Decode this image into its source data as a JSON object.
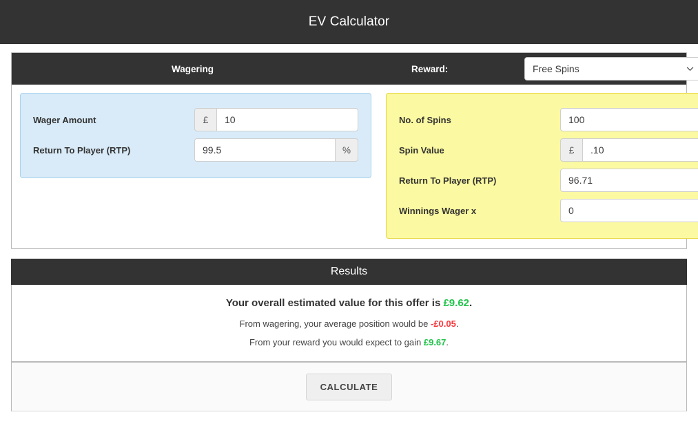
{
  "app": {
    "title": "EV Calculator",
    "accent_dark": "#333333",
    "panel_wagering_bg": "#d9ebf8",
    "panel_reward_bg": "#fbf9a1",
    "positive_color": "#21c44a",
    "negative_color": "#f8373d"
  },
  "card_header": {
    "wagering_label": "Wagering",
    "reward_label": "Reward:",
    "reward_select": {
      "value": "Free Spins",
      "options": [
        "Free Spins"
      ]
    },
    "chevron_icon": "chevron-down-icon"
  },
  "wagering_panel": {
    "fields": [
      {
        "label": "Wager Amount",
        "prefix": "£",
        "suffix": "",
        "value": "10",
        "placeholder": ""
      },
      {
        "label": "Return To Player (RTP)",
        "prefix": "",
        "suffix": "%",
        "value": "99.5",
        "placeholder": ""
      }
    ]
  },
  "reward_panel": {
    "fields": [
      {
        "label": "No. of Spins",
        "prefix": "",
        "suffix": "",
        "value": "100",
        "placeholder": ""
      },
      {
        "label": "Spin Value",
        "prefix": "£",
        "suffix": "",
        "value": ".10",
        "placeholder": ""
      },
      {
        "label": "Return To Player (RTP)",
        "prefix": "",
        "suffix": "%",
        "value": "96.71",
        "placeholder": ""
      }
    ],
    "wager_select": {
      "label": "Winnings Wager x",
      "value": "0",
      "options": [
        "0"
      ]
    }
  },
  "results": {
    "heading": "Results",
    "overall": {
      "prefix": "Your overall estimated value for this offer is ",
      "value": "£9.62",
      "suffix": ".",
      "sign": "positive"
    },
    "wagering": {
      "prefix": "From wagering, your average position would be ",
      "value": "-£0.05",
      "suffix": ".",
      "sign": "negative"
    },
    "reward": {
      "prefix": "From your reward you would expect to gain ",
      "value": "£9.67",
      "suffix": ".",
      "sign": "positive"
    }
  },
  "footer": {
    "calculate_label": "CALCULATE"
  }
}
